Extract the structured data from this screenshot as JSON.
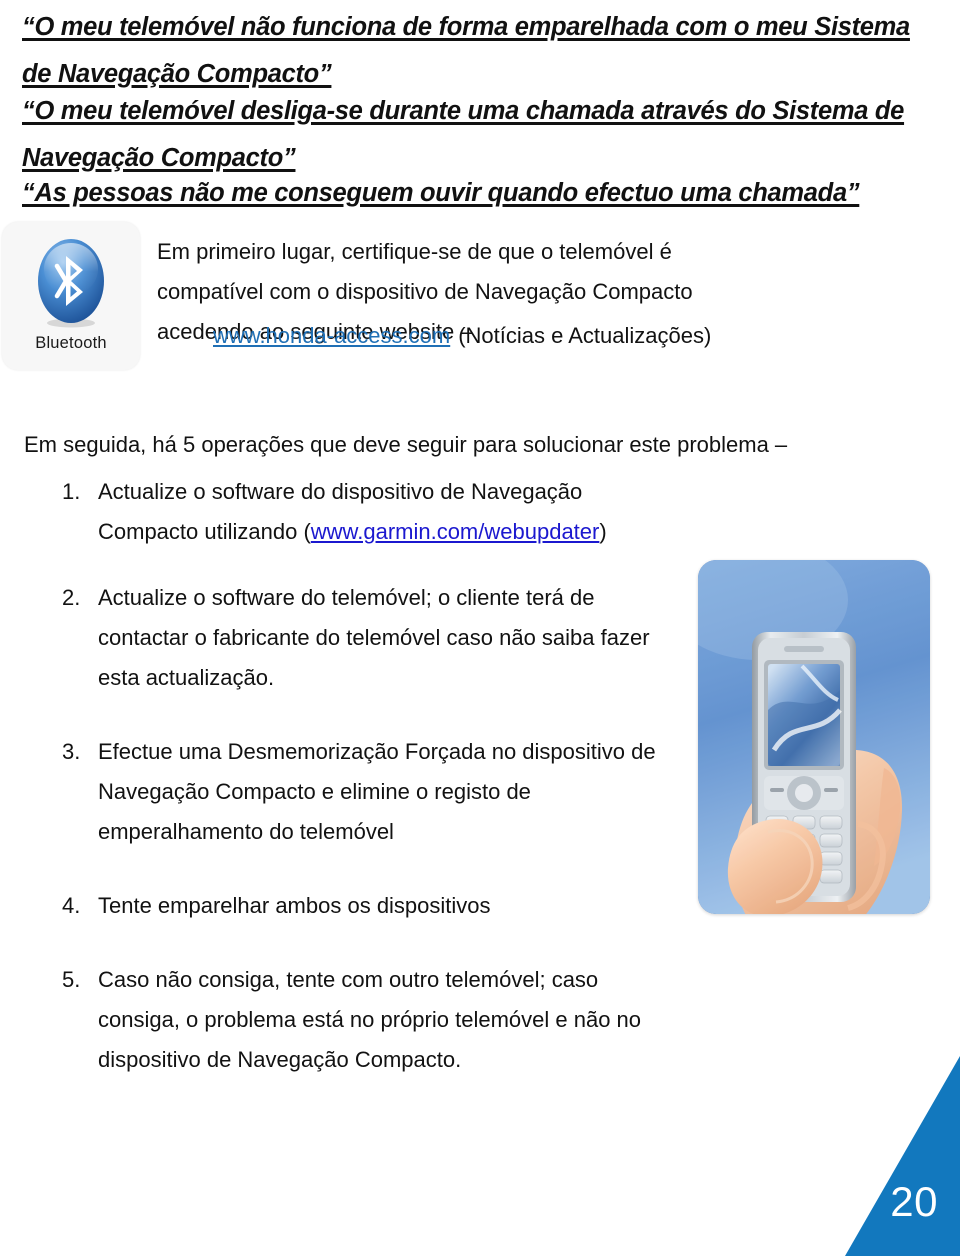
{
  "slide": {
    "page_number": "20",
    "accent_color": "#1278BE",
    "link_color": "#1F6FB5",
    "link_color_alt": "#1B18CF"
  },
  "headings": [
    "“O meu telemóvel não funciona de forma emparelhada com o meu Sistema de Navegação Compacto”",
    "“O meu telemóvel desliga-se durante uma chamada através do Sistema de Navegação Compacto”",
    "“As pessoas não me conseguem ouvir quando efectuo uma chamada”"
  ],
  "bluetooth_badge": {
    "icon": "bluetooth-icon",
    "label": "Bluetooth"
  },
  "intro": {
    "paragraph": "Em primeiro lugar, certifique-se de que o telemóvel é compatível com o dispositivo de Navegação Compacto acedendo ao seguinte website –",
    "link_text": "www.honda-access.com",
    "link_suffix": "(Notícias e Actualizações)"
  },
  "lead_line": "Em seguida, há 5 operações que deve seguir para solucionar este problema –",
  "steps": [
    {
      "number": "1.",
      "text_before": "Actualize o software do dispositivo de Navegação Compacto utilizando (",
      "link_text": "www.garmin.com/webupdater",
      "text_after": ")"
    },
    {
      "number": "2.",
      "text_before": "Actualize o software do telemóvel; o cliente terá de contactar o fabricante do telemóvel caso não saiba fazer esta actualização.",
      "link_text": "",
      "text_after": ""
    },
    {
      "number": "3.",
      "text_before": "Efectue uma Desmemorização Forçada no dispositivo de Navegação Compacto e elimine o registo de emperalhamento do telemóvel",
      "link_text": "",
      "text_after": ""
    },
    {
      "number": "4.",
      "text_before": "Tente emparelhar ambos os dispositivos",
      "link_text": "",
      "text_after": ""
    },
    {
      "number": "5.",
      "text_before": "Caso não consiga, tente com outro telemóvel; caso consiga, o problema está no próprio telemóvel e não no dispositivo de Navegação Compacto.",
      "link_text": "",
      "text_after": ""
    }
  ],
  "phone_photo": {
    "alt": "mobile-phone-in-hand-photo"
  }
}
